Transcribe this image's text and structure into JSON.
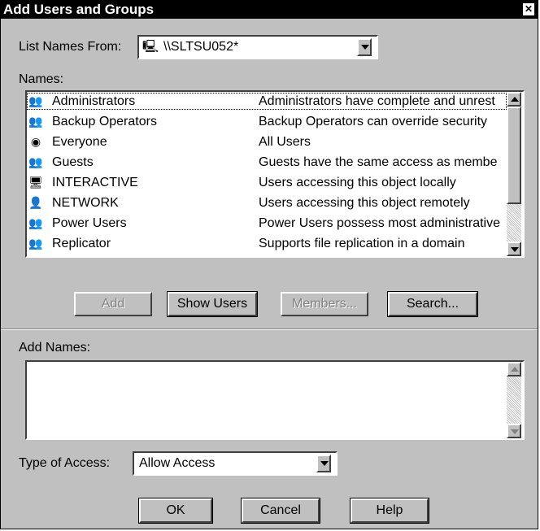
{
  "window": {
    "title": "Add Users and Groups",
    "close_glyph": "✕"
  },
  "list_names_from": {
    "label": "List Names From:",
    "value": "\\\\SLTSU052*"
  },
  "names": {
    "label": "Names:",
    "items": [
      {
        "name": "Administrators",
        "description": "Administrators have complete and unrest",
        "icon": "group-icon",
        "glyph": "👥"
      },
      {
        "name": "Backup Operators",
        "description": "Backup Operators can override security",
        "icon": "group-icon",
        "glyph": "👥"
      },
      {
        "name": "Everyone",
        "description": "All Users",
        "icon": "globe-icon",
        "glyph": "◉"
      },
      {
        "name": "Guests",
        "description": "Guests have the same access as membe",
        "icon": "group-icon",
        "glyph": "👥"
      },
      {
        "name": "INTERACTIVE",
        "description": "Users accessing this object locally",
        "icon": "interactive-icon",
        "glyph": "🖥"
      },
      {
        "name": "NETWORK",
        "description": "Users accessing this object remotely",
        "icon": "network-icon",
        "glyph": "👤"
      },
      {
        "name": "Power Users",
        "description": "Power Users possess most administrative",
        "icon": "group-icon",
        "glyph": "👥"
      },
      {
        "name": "Replicator",
        "description": "Supports file replication in a domain",
        "icon": "group-icon",
        "glyph": "👥"
      }
    ]
  },
  "buttons": {
    "add": "Add",
    "show_users": "Show Users",
    "members": "Members...",
    "search": "Search..."
  },
  "add_names": {
    "label": "Add Names:",
    "value": ""
  },
  "type_of_access": {
    "label": "Type of Access:",
    "value": "Allow Access"
  },
  "footer": {
    "ok": "OK",
    "cancel": "Cancel",
    "help": "Help"
  }
}
